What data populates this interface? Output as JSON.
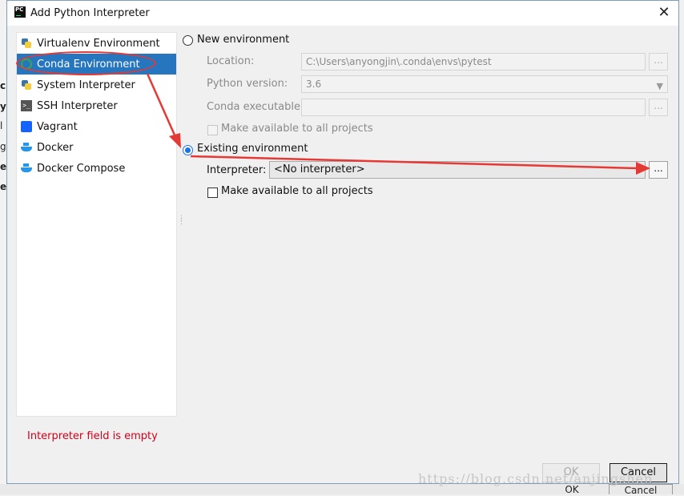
{
  "window": {
    "title": "Add Python Interpreter",
    "app_icon_text": "PC"
  },
  "background": {
    "left_chars": [
      "c",
      "y",
      "l",
      "g",
      "ec",
      "es"
    ],
    "ok_label": "OK",
    "cancel_label": "Cancel"
  },
  "sidebar": {
    "items": [
      {
        "label": "Virtualenv Environment",
        "icon": "virtualenv-icon",
        "selected": false
      },
      {
        "label": "Conda Environment",
        "icon": "conda-icon",
        "selected": true
      },
      {
        "label": "System Interpreter",
        "icon": "python-icon",
        "selected": false
      },
      {
        "label": "SSH Interpreter",
        "icon": "terminal-icon",
        "selected": false
      },
      {
        "label": "Vagrant",
        "icon": "vagrant-icon",
        "selected": false
      },
      {
        "label": "Docker",
        "icon": "docker-icon",
        "selected": false
      },
      {
        "label": "Docker Compose",
        "icon": "docker-compose-icon",
        "selected": false
      }
    ]
  },
  "new_env": {
    "radio_label": "New environment",
    "location_label": "Location:",
    "location_value": "C:\\Users\\anyongjin\\.conda\\envs\\pytest",
    "python_version_label": "Python version:",
    "python_version_value": "3.6",
    "conda_exec_label": "Conda executable:",
    "conda_exec_value": "",
    "make_available_label": "Make available to all projects",
    "browse_label": "..."
  },
  "existing_env": {
    "radio_label": "Existing environment",
    "interpreter_label": "Interpreter:",
    "interpreter_value": "<No interpreter>",
    "browse_label": "...",
    "make_available_label": "Make available to all projects"
  },
  "error": "Interpreter field is empty",
  "buttons": {
    "ok": "OK",
    "cancel": "Cancel"
  },
  "watermark": "https://blog.csdn.net/anjingshen",
  "colors": {
    "selection": "#2675bf",
    "error": "#d0021b",
    "annotation": "#e53935",
    "radio_accent": "#1a73e8"
  }
}
